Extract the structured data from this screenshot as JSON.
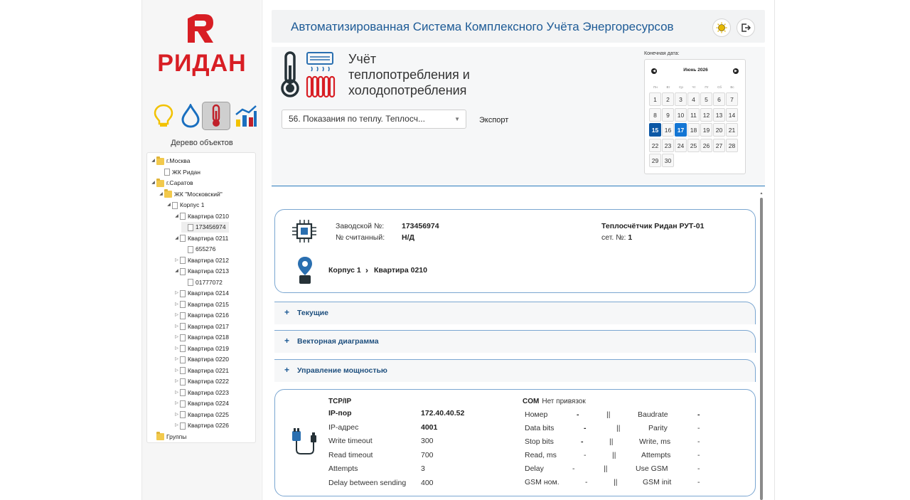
{
  "brand": {
    "name": "РИДАН",
    "accent": "#d81e24"
  },
  "sidebar": {
    "resource_icons": [
      "bulb-icon",
      "water-drop-icon",
      "thermometer-icon",
      "chart-icon"
    ],
    "tree_title": "Дерево объектов",
    "tree": [
      {
        "label": "г.Москва",
        "type": "folder",
        "expanded": true,
        "level": 0
      },
      {
        "label": "ЖК Ридан",
        "type": "doc",
        "level": 1
      },
      {
        "label": "г.Саратов",
        "type": "folder",
        "expanded": true,
        "level": 0
      },
      {
        "label": "ЖК \"Московский\"",
        "type": "folder",
        "expanded": true,
        "level": 1
      },
      {
        "label": "Корпус 1",
        "type": "doc",
        "expanded": true,
        "level": 2
      },
      {
        "label": "Квартира 0210",
        "type": "doc",
        "expanded": true,
        "level": 3
      },
      {
        "label": "173456974",
        "type": "doc",
        "level": 4,
        "selected": true
      },
      {
        "label": "Квартира 0211",
        "type": "doc",
        "expanded": true,
        "level": 3
      },
      {
        "label": "655276",
        "type": "doc",
        "level": 4
      },
      {
        "label": "Квартира 0212",
        "type": "doc",
        "expanded": false,
        "level": 3
      },
      {
        "label": "Квартира 0213",
        "type": "doc",
        "expanded": true,
        "level": 3
      },
      {
        "label": "01777072",
        "type": "doc",
        "level": 4
      },
      {
        "label": "Квартира 0214",
        "type": "doc",
        "expanded": false,
        "level": 3
      },
      {
        "label": "Квартира 0215",
        "type": "doc",
        "expanded": false,
        "level": 3
      },
      {
        "label": "Квартира 0216",
        "type": "doc",
        "expanded": false,
        "level": 3
      },
      {
        "label": "Квартира 0217",
        "type": "doc",
        "expanded": false,
        "level": 3
      },
      {
        "label": "Квартира 0218",
        "type": "doc",
        "expanded": false,
        "level": 3
      },
      {
        "label": "Квартира 0219",
        "type": "doc",
        "expanded": false,
        "level": 3
      },
      {
        "label": "Квартира 0220",
        "type": "doc",
        "expanded": false,
        "level": 3
      },
      {
        "label": "Квартира 0221",
        "type": "doc",
        "expanded": false,
        "level": 3
      },
      {
        "label": "Квартира 0222",
        "type": "doc",
        "expanded": false,
        "level": 3
      },
      {
        "label": "Квартира 0223",
        "type": "doc",
        "expanded": false,
        "level": 3
      },
      {
        "label": "Квартира 0224",
        "type": "doc",
        "expanded": false,
        "level": 3
      },
      {
        "label": "Квартира 0225",
        "type": "doc",
        "expanded": false,
        "level": 3
      },
      {
        "label": "Квартира 0226",
        "type": "doc",
        "expanded": false,
        "level": 3
      },
      {
        "label": "Группы",
        "type": "folder",
        "level": 0
      }
    ]
  },
  "header": {
    "title": "Автоматизированная Система Комплексного Учёта Энергоресурсов",
    "theme_icon": "sun-icon",
    "logout_icon": "logout-icon"
  },
  "section": {
    "title_line1": "Учёт",
    "title_line2": "теплопотребления и",
    "title_line3": "холодопотребления",
    "report_select": "56. Показания по теплу. Теплосч...",
    "export_label": "Экспорт"
  },
  "calendar": {
    "label": "Конечная дата:",
    "month": "Июнь 2026",
    "prev": "◀",
    "next": "▶",
    "dow": [
      "Пн",
      "Вт",
      "Ср",
      "Чт",
      "Пт",
      "Сб",
      "Вс"
    ],
    "days": [
      "1",
      "2",
      "3",
      "4",
      "5",
      "6",
      "7",
      "8",
      "9",
      "10",
      "11",
      "12",
      "13",
      "14",
      "15",
      "16",
      "17",
      "18",
      "19",
      "20",
      "21",
      "22",
      "23",
      "24",
      "25",
      "26",
      "27",
      "28",
      "29",
      "30"
    ],
    "selected": "15",
    "today": "17"
  },
  "device": {
    "serial_label": "Заводской №:",
    "serial": "173456974",
    "reader_label": "№ считанный:",
    "reader": "Н/Д",
    "model": "Теплосчётчик Ридан РУТ-01",
    "net_label": "сет. №:",
    "net": "1",
    "path_building": "Корпус 1",
    "path_apartment": "Квартира 0210"
  },
  "accordions": [
    "Текущие",
    "Векторная диаграмма",
    "Управление мощностью"
  ],
  "tcp": {
    "title": "TCP/IP",
    "rows": [
      {
        "label": "IP-пор",
        "value": "172.40.40.52",
        "bold": true
      },
      {
        "label": "IP-адрес",
        "value": "4001",
        "bold": false
      },
      {
        "label": "Write timeout",
        "value": "300",
        "bold": false
      },
      {
        "label": "Read timeout",
        "value": "700",
        "bold": false
      },
      {
        "label": "Attempts",
        "value": "3",
        "bold": false
      },
      {
        "label": "Delay between sending",
        "value": "400",
        "bold": false
      }
    ]
  },
  "com": {
    "title": "COM",
    "subtitle": "Нет привязок",
    "rows": [
      {
        "left": "Номер",
        "lval": "-",
        "sep": "||",
        "right": "Baudrate",
        "rval": "-"
      },
      {
        "left": "Data bits",
        "lval": "-",
        "sep": "||",
        "right": "Parity",
        "rval": "-"
      },
      {
        "left": "Stop bits",
        "lval": "-",
        "sep": "||",
        "right": "Write, ms",
        "rval": "-"
      },
      {
        "left": "Read, ms",
        "lval": "-",
        "sep": "||",
        "right": "Attempts",
        "rval": "-"
      },
      {
        "left": "Delay",
        "lval": "-",
        "sep": "||",
        "right": "Use GSM",
        "rval": "-"
      },
      {
        "left": "GSM ном.",
        "lval": "-",
        "sep": "||",
        "right": "GSM init",
        "rval": "-"
      }
    ]
  }
}
